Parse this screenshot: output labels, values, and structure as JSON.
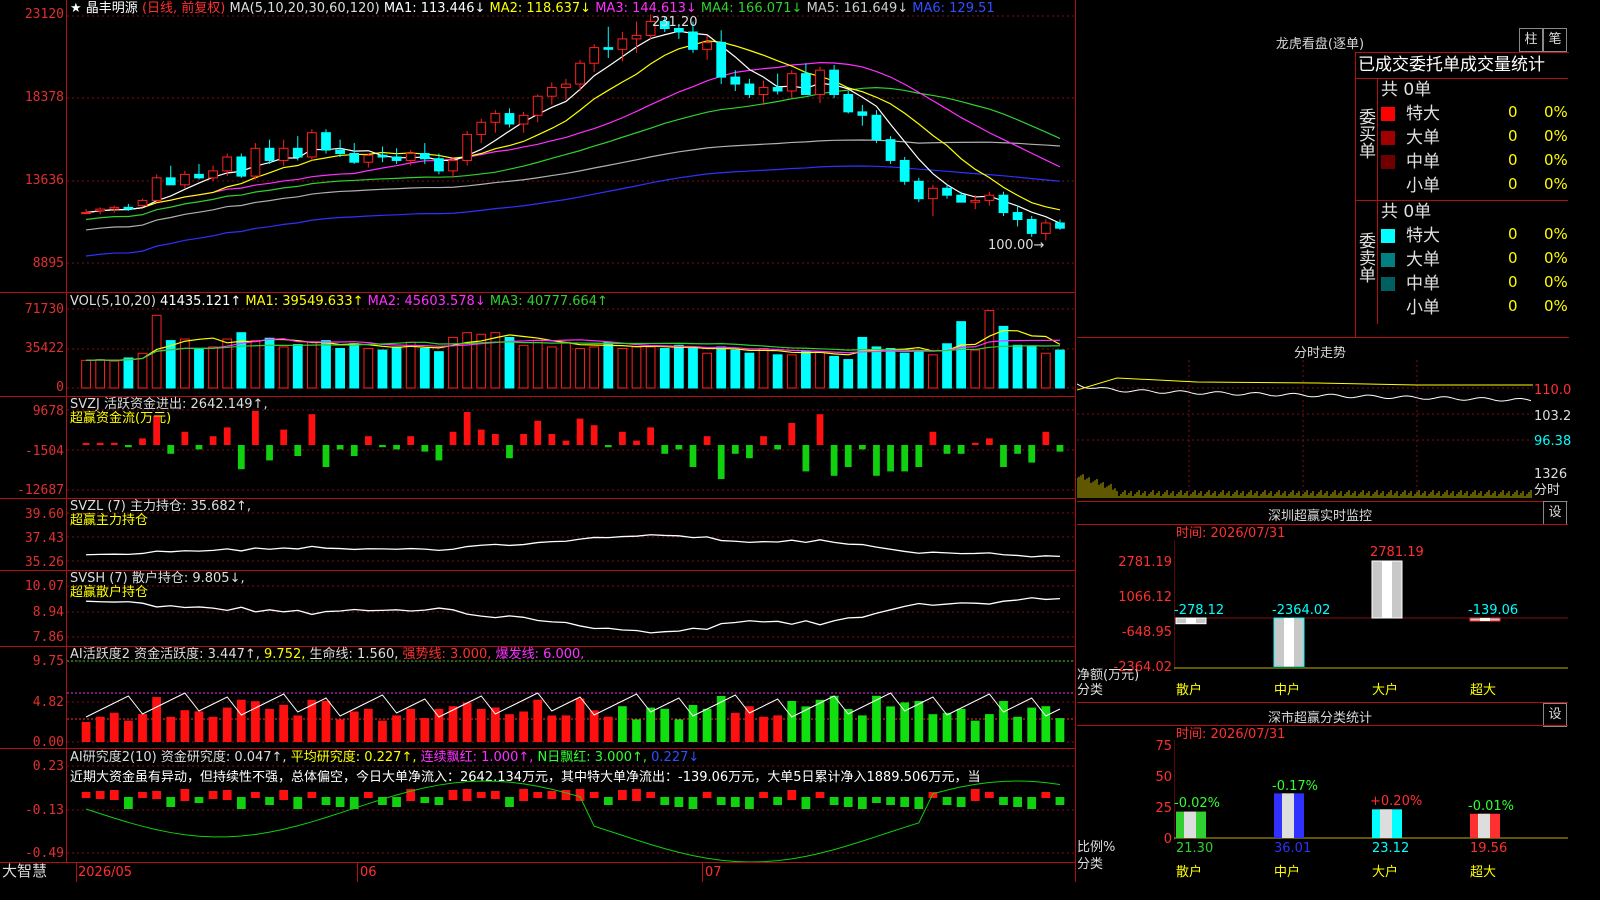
{
  "header": {
    "star": "★",
    "stock_name": "晶丰明源",
    "mode": "(日线, 前复权)",
    "ma_label": "MA(5,10,20,30,60,120)",
    "ma1": "MA1: 113.446↓",
    "ma2": "MA2: 118.637↓",
    "ma3": "MA3: 144.613↓",
    "ma4": "MA4: 166.071↓",
    "ma5": "MA5: 161.649↓",
    "ma6": "MA6: 129.51"
  },
  "colors": {
    "up": "#ff2020",
    "down": "#00ffff",
    "ma1": "#ffffff",
    "ma2": "#ffff00",
    "ma3": "#ff30ff",
    "ma4": "#30d030",
    "ma5": "#b0b0b0",
    "ma6": "#3030ff",
    "grid": "#b01010"
  },
  "price_axis": {
    "labels": [
      "23120",
      "18378",
      "13636",
      "8895"
    ]
  },
  "price_annotations": {
    "high": "231.20",
    "low": "100.00"
  },
  "vol": {
    "label": "VOL(5,10,20)",
    "value": "41435.121↑",
    "ma1": "MA1: 39549.633↑",
    "ma2": "MA2: 45603.578↓",
    "ma3": "MA3: 40777.664↑",
    "axis": [
      "71730",
      "35422",
      "0"
    ]
  },
  "svzj": {
    "label": "SVZJ  活跃资金进出: 2642.149↑,",
    "sub": "超赢资金流(万元)",
    "axis": [
      "9678",
      "-1504",
      "-12687"
    ]
  },
  "svzl": {
    "label": "SVZL (7) 主力持仓: 35.682↑,",
    "sub": "超赢主力持仓",
    "axis": [
      "39.60",
      "37.43",
      "35.26"
    ]
  },
  "svsh": {
    "label": "SVSH (7) 散户持仓: 9.805↓,",
    "sub": "超赢散户持仓",
    "axis": [
      "10.07",
      "8.94",
      "7.86"
    ]
  },
  "ai1": {
    "label": "AI活跃度2 资金活跃度: 3.447↑,",
    "v2": "9.752,",
    "life": "生命线: 1.560,",
    "strong": "强势线: 3.000,",
    "burst": "爆发线: 6.000,",
    "axis": [
      "9.75",
      "4.82",
      "0.00"
    ]
  },
  "ai2": {
    "label": "AI研究度2(10) 资金研究度: 0.047↑,",
    "avg": "平均研究度: 0.227↑,",
    "red": "连续飘红: 1.000↑,",
    "nred": "N日飘红: 3.000↑,",
    "last": "0.227↓",
    "text": "近期大资金虽有异动，但持续性不强，总体偏空，今日大单净流入：2642.134万元，其中特大单净流出：-139.06万元，大单5日累计净入1889.506万元，当",
    "axis": [
      "0.23",
      "-0.13",
      "-0.49"
    ]
  },
  "bottom": {
    "brand": "大智慧",
    "dates": [
      "2026/05",
      "06",
      "07"
    ]
  },
  "right": {
    "lhb_title": "龙虎看盘(逐单)",
    "btn_zhu": "柱",
    "btn_bi": "笔",
    "tabs_text": "已成交委托单成交量统计",
    "buy_label": "委买单",
    "sell_label": "委卖单",
    "buy_total": "共 0单",
    "sell_total": "共 0单",
    "rows_buy": [
      {
        "name": "特大",
        "v": "0",
        "p": "0%",
        "c": "#ff0000"
      },
      {
        "name": "大单",
        "v": "0",
        "p": "0%",
        "c": "#a00000"
      },
      {
        "name": "中单",
        "v": "0",
        "p": "0%",
        "c": "#700000"
      },
      {
        "name": "小单",
        "v": "0",
        "p": "0%",
        "c": "#000000"
      }
    ],
    "rows_sell": [
      {
        "name": "特大",
        "v": "0",
        "p": "0%",
        "c": "#00ffff"
      },
      {
        "name": "大单",
        "v": "0",
        "p": "0%",
        "c": "#008080"
      },
      {
        "name": "中单",
        "v": "0",
        "p": "0%",
        "c": "#006060"
      },
      {
        "name": "小单",
        "v": "0",
        "p": "0%",
        "c": "#000000"
      }
    ],
    "fs_title": "分时走势",
    "fs_axis": [
      "110.0",
      "103.2",
      "96.38",
      "1326",
      "分时"
    ],
    "sz_title": "深圳超赢实时监控",
    "sz_set": "设",
    "sz_time": "时间: 2026/07/31",
    "sz_axis": [
      "2781.19",
      "1066.12",
      "-648.95",
      "-2364.02"
    ],
    "sz_unit": "净额(万元)",
    "sz_cls": "分类",
    "sz_vals": [
      "-278.12",
      "-2364.02",
      "2781.19",
      "-139.06"
    ],
    "sz_cats": [
      "散户",
      "中户",
      "大户",
      "超大"
    ],
    "ss_title": "深市超赢分类统计",
    "ss_set": "设",
    "ss_time": "时间: 2026/07/31",
    "ss_axis": [
      "75",
      "50",
      "25",
      "0"
    ],
    "ss_unit": "比例%",
    "ss_cls": "分类",
    "ss_pct": [
      "-0.02%",
      "-0.17%",
      "+0.20%",
      "-0.01%"
    ],
    "ss_vals": [
      "21.30",
      "36.01",
      "23.12",
      "19.56"
    ],
    "ss_cats": [
      "散户",
      "中户",
      "大户",
      "超大"
    ]
  },
  "chart_data": {
    "type": "candlestick",
    "candles": [
      [
        118,
        120,
        117,
        118
      ],
      [
        119,
        121,
        117,
        120
      ],
      [
        120,
        122,
        118,
        121
      ],
      [
        121,
        123,
        119,
        120
      ],
      [
        122,
        126,
        121,
        125
      ],
      [
        125,
        140,
        124,
        138
      ],
      [
        138,
        145,
        134,
        134
      ],
      [
        134,
        142,
        132,
        140
      ],
      [
        140,
        146,
        137,
        138
      ],
      [
        138,
        145,
        136,
        142
      ],
      [
        142,
        152,
        139,
        150
      ],
      [
        150,
        152,
        138,
        139
      ],
      [
        139,
        158,
        137,
        155
      ],
      [
        155,
        160,
        146,
        148
      ],
      [
        148,
        160,
        145,
        155
      ],
      [
        155,
        162,
        148,
        150
      ],
      [
        150,
        166,
        148,
        164
      ],
      [
        164,
        166,
        152,
        154
      ],
      [
        154,
        160,
        150,
        152
      ],
      [
        152,
        158,
        146,
        147
      ],
      [
        147,
        152,
        144,
        151
      ],
      [
        151,
        156,
        147,
        150
      ],
      [
        150,
        155,
        146,
        148
      ],
      [
        148,
        154,
        145,
        152
      ],
      [
        152,
        158,
        146,
        149
      ],
      [
        149,
        152,
        140,
        142
      ],
      [
        142,
        150,
        138,
        148
      ],
      [
        148,
        165,
        145,
        163
      ],
      [
        163,
        172,
        158,
        170
      ],
      [
        170,
        177,
        164,
        175
      ],
      [
        175,
        178,
        167,
        169
      ],
      [
        169,
        176,
        164,
        174
      ],
      [
        174,
        186,
        170,
        185
      ],
      [
        185,
        193,
        180,
        190
      ],
      [
        190,
        195,
        183,
        192
      ],
      [
        192,
        206,
        188,
        204
      ],
      [
        204,
        215,
        199,
        213
      ],
      [
        213,
        225,
        207,
        212
      ],
      [
        212,
        222,
        205,
        218
      ],
      [
        218,
        228,
        210,
        220
      ],
      [
        220,
        232,
        218,
        228
      ],
      [
        228,
        231,
        222,
        224
      ],
      [
        224,
        226,
        218,
        222
      ],
      [
        222,
        228,
        210,
        212
      ],
      [
        212,
        220,
        206,
        216
      ],
      [
        216,
        223,
        192,
        196
      ],
      [
        196,
        200,
        188,
        192
      ],
      [
        192,
        195,
        184,
        186
      ],
      [
        186,
        194,
        180,
        190
      ],
      [
        190,
        198,
        186,
        188
      ],
      [
        188,
        200,
        184,
        198
      ],
      [
        198,
        204,
        186,
        186
      ],
      [
        186,
        202,
        181,
        200
      ],
      [
        200,
        203,
        184,
        186
      ],
      [
        186,
        188,
        175,
        176
      ],
      [
        176,
        180,
        168,
        174
      ],
      [
        174,
        177,
        158,
        160
      ],
      [
        160,
        162,
        146,
        148
      ],
      [
        148,
        150,
        134,
        136
      ],
      [
        136,
        138,
        124,
        126
      ],
      [
        126,
        134,
        116,
        132
      ],
      [
        132,
        134,
        126,
        128
      ],
      [
        128,
        130,
        124,
        124
      ],
      [
        124,
        128,
        120,
        125
      ],
      [
        125,
        130,
        122,
        128
      ],
      [
        128,
        130,
        116,
        118
      ],
      [
        118,
        122,
        110,
        114
      ],
      [
        114,
        116,
        104,
        106
      ],
      [
        106,
        114,
        102,
        112
      ],
      [
        112,
        114,
        108,
        109
      ]
    ],
    "volume": [
      35,
      36,
      34,
      38,
      44,
      92,
      60,
      62,
      50,
      52,
      62,
      70,
      60,
      63,
      52,
      55,
      58,
      60,
      50,
      56,
      50,
      48,
      52,
      58,
      50,
      46,
      64,
      70,
      68,
      70,
      64,
      54,
      60,
      52,
      58,
      50,
      52,
      58,
      50,
      52,
      52,
      50,
      54,
      50,
      44,
      52,
      48,
      44,
      50,
      42,
      42,
      46,
      46,
      40,
      36,
      64,
      52,
      50,
      44,
      46,
      42,
      56,
      84,
      48,
      98,
      78,
      54,
      52,
      44,
      48
    ],
    "ylim": [
      88.95,
      231.2
    ],
    "note": "prices in yuan (axis labels x100); volume in thousands scale"
  }
}
